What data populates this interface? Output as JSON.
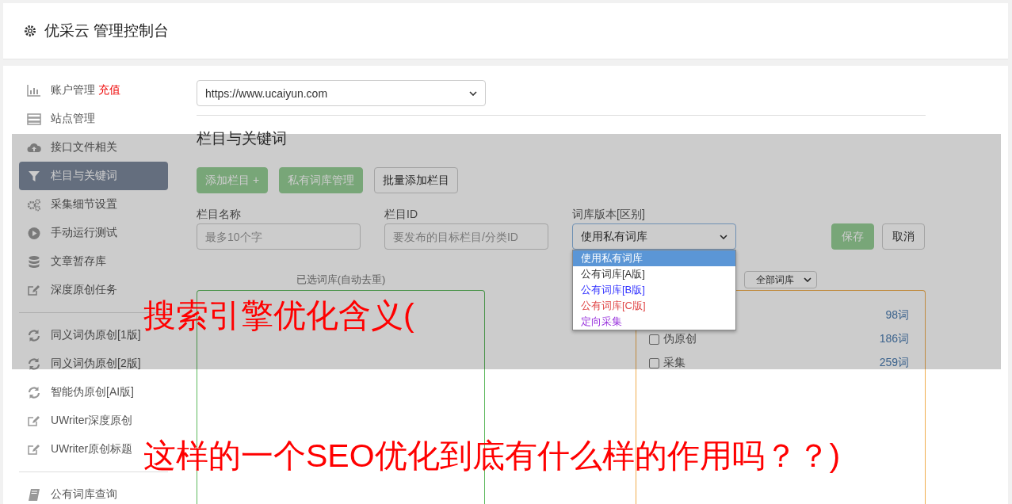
{
  "header": {
    "title": "优采云 管理控制台"
  },
  "sidebar": {
    "groups": [
      [
        {
          "label": "账户管理",
          "badge": "充值",
          "kind": "chart",
          "selected": false
        },
        {
          "label": "站点管理",
          "kind": "server",
          "selected": false
        },
        {
          "label": "接口文件相关",
          "kind": "cloud",
          "selected": false
        },
        {
          "label": "栏目与关键词",
          "kind": "filter",
          "selected": true
        },
        {
          "label": "采集细节设置",
          "kind": "gears",
          "selected": false
        },
        {
          "label": "手动运行测试",
          "kind": "play",
          "selected": false
        },
        {
          "label": "文章暂存库",
          "kind": "database",
          "selected": false
        },
        {
          "label": "深度原创任务",
          "kind": "edit",
          "selected": false
        }
      ],
      [
        {
          "label": "同义词伪原创[1版]",
          "kind": "refresh",
          "selected": false
        },
        {
          "label": "同义词伪原创[2版]",
          "kind": "refresh",
          "selected": false
        },
        {
          "label": "智能伪原创[AI版]",
          "kind": "refresh",
          "selected": false
        },
        {
          "label": "UWriter深度原创",
          "kind": "edit",
          "selected": false
        },
        {
          "label": "UWriter原创标题",
          "kind": "edit",
          "selected": false
        }
      ],
      [
        {
          "label": "公有词库查询",
          "kind": "book",
          "selected": false
        }
      ]
    ]
  },
  "main": {
    "site_select": {
      "value": "https://www.ucaiyun.com"
    },
    "section_title": "栏目与关键词",
    "buttons": [
      {
        "label": "添加栏目 +",
        "kind": "primary"
      },
      {
        "label": "私有词库管理",
        "kind": "primary"
      },
      {
        "label": "批量添加栏目",
        "kind": "default"
      }
    ],
    "fields": [
      {
        "label": "栏目名称",
        "placeholder": "最多10个字",
        "kind": "input"
      },
      {
        "label": "栏目ID",
        "placeholder": "要发布的目标栏目/分类ID",
        "kind": "input"
      },
      {
        "label": "词库版本[区别]",
        "value": "使用私有词库",
        "kind": "select"
      }
    ],
    "actions": [
      {
        "label": "保存",
        "kind": "primary"
      },
      {
        "label": "取消",
        "kind": "default"
      }
    ],
    "dropdown": {
      "options": [
        {
          "label": "使用私有词库",
          "selected": true
        },
        {
          "label": "公有词库[A版]",
          "selected": false,
          "color": "#333333"
        },
        {
          "label": "公有词库[B版]",
          "selected": false,
          "color": "#3333ff"
        },
        {
          "label": "公有词库[C版]",
          "selected": false,
          "color": "#e04848"
        },
        {
          "label": "定向采集",
          "selected": false,
          "color": "#9933dd"
        }
      ]
    },
    "selected_panel": {
      "title": "已选词库(自动去重)"
    },
    "library_panel": {
      "filter": "全部词库",
      "rows": [
        {
          "count": "98词"
        },
        {
          "label": "伪原创",
          "checked": false,
          "count": "186词"
        },
        {
          "label": "采集",
          "checked": false,
          "count": "259词"
        }
      ]
    }
  },
  "captions": [
    "搜索引擎优化含义(",
    "这样的一个SEO优化到底有什么样的作用吗？？)"
  ]
}
